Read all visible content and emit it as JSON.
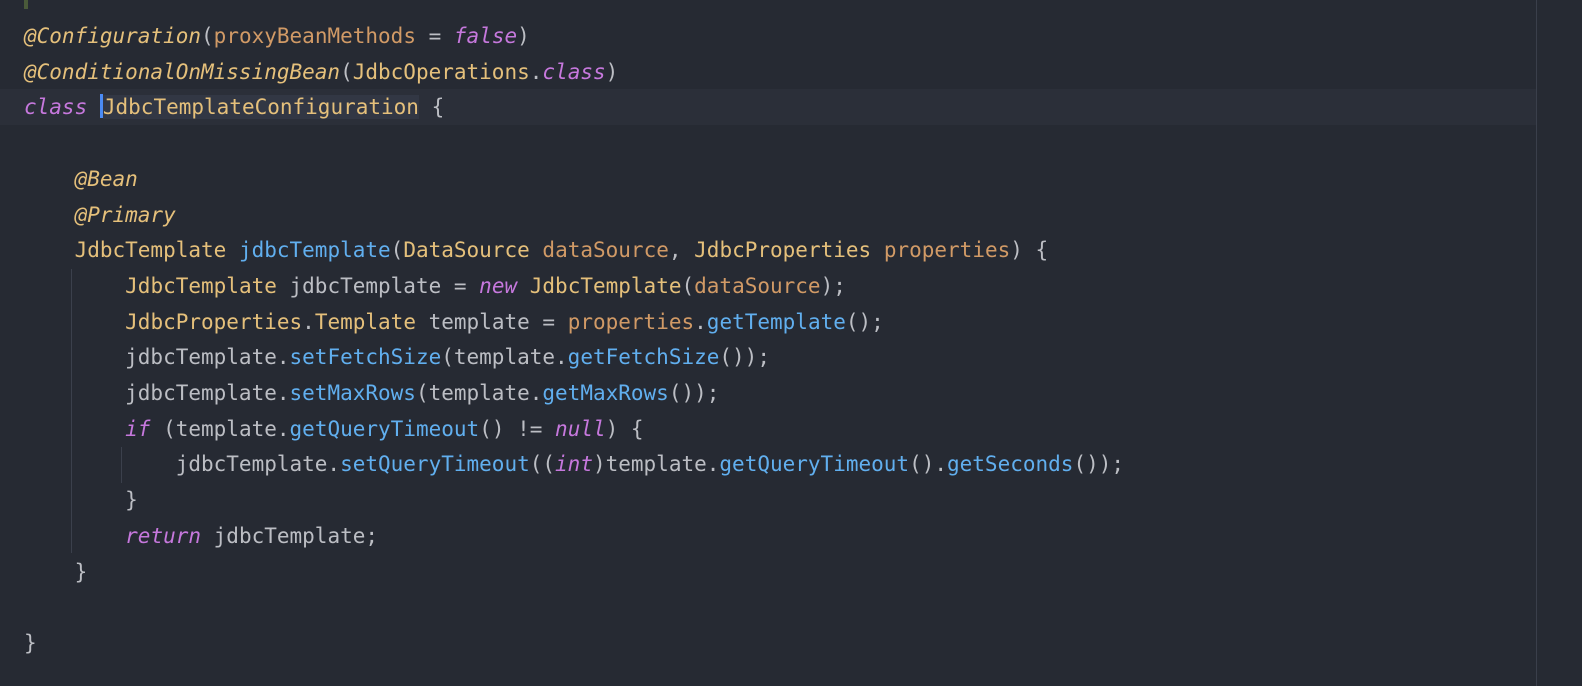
{
  "editor": {
    "lines": [
      {
        "tokens": [
          {
            "t": "@Configuration",
            "c": "ann"
          },
          {
            "t": "(",
            "c": "punct"
          },
          {
            "t": "proxyBeanMethods",
            "c": "param"
          },
          {
            "t": " = ",
            "c": "plain"
          },
          {
            "t": "false",
            "c": "kw"
          },
          {
            "t": ")",
            "c": "punct"
          }
        ]
      },
      {
        "tokens": [
          {
            "t": "@ConditionalOnMissingBean",
            "c": "ann"
          },
          {
            "t": "(",
            "c": "punct"
          },
          {
            "t": "JdbcOperations",
            "c": "type"
          },
          {
            "t": ".",
            "c": "punct"
          },
          {
            "t": "class",
            "c": "kw"
          },
          {
            "t": ")",
            "c": "punct"
          }
        ]
      },
      {
        "current": true,
        "tokens": [
          {
            "t": "class",
            "c": "kw"
          },
          {
            "t": " ",
            "c": "plain"
          },
          {
            "t": "JdbcTemplateConfiguration",
            "c": "type",
            "caret": true,
            "hl": true
          },
          {
            "t": " {",
            "c": "punct"
          }
        ]
      },
      {
        "tokens": []
      },
      {
        "tokens": [
          {
            "t": "    ",
            "c": "plain"
          },
          {
            "t": "@Bean",
            "c": "ann"
          }
        ]
      },
      {
        "tokens": [
          {
            "t": "    ",
            "c": "plain"
          },
          {
            "t": "@Primary",
            "c": "ann"
          }
        ]
      },
      {
        "tokens": [
          {
            "t": "    ",
            "c": "plain"
          },
          {
            "t": "JdbcTemplate",
            "c": "type"
          },
          {
            "t": " ",
            "c": "plain"
          },
          {
            "t": "jdbcTemplate",
            "c": "fn"
          },
          {
            "t": "(",
            "c": "punct"
          },
          {
            "t": "DataSource",
            "c": "type"
          },
          {
            "t": " ",
            "c": "plain"
          },
          {
            "t": "dataSource",
            "c": "param"
          },
          {
            "t": ", ",
            "c": "punct"
          },
          {
            "t": "JdbcProperties",
            "c": "type"
          },
          {
            "t": " ",
            "c": "plain"
          },
          {
            "t": "properties",
            "c": "param"
          },
          {
            "t": ") {",
            "c": "punct"
          }
        ]
      },
      {
        "tokens": [
          {
            "t": "        ",
            "c": "plain"
          },
          {
            "t": "JdbcTemplate",
            "c": "type"
          },
          {
            "t": " jdbcTemplate = ",
            "c": "plain"
          },
          {
            "t": "new",
            "c": "kw"
          },
          {
            "t": " ",
            "c": "plain"
          },
          {
            "t": "JdbcTemplate",
            "c": "type"
          },
          {
            "t": "(",
            "c": "punct"
          },
          {
            "t": "dataSource",
            "c": "param"
          },
          {
            "t": ");",
            "c": "punct"
          }
        ]
      },
      {
        "tokens": [
          {
            "t": "        ",
            "c": "plain"
          },
          {
            "t": "JdbcProperties",
            "c": "type"
          },
          {
            "t": ".",
            "c": "punct"
          },
          {
            "t": "Template",
            "c": "type"
          },
          {
            "t": " template = ",
            "c": "plain"
          },
          {
            "t": "properties",
            "c": "param"
          },
          {
            "t": ".",
            "c": "punct"
          },
          {
            "t": "getTemplate",
            "c": "fn"
          },
          {
            "t": "();",
            "c": "punct"
          }
        ]
      },
      {
        "tokens": [
          {
            "t": "        jdbcTemplate.",
            "c": "plain"
          },
          {
            "t": "setFetchSize",
            "c": "fn"
          },
          {
            "t": "(template.",
            "c": "plain"
          },
          {
            "t": "getFetchSize",
            "c": "fn"
          },
          {
            "t": "());",
            "c": "punct"
          }
        ]
      },
      {
        "tokens": [
          {
            "t": "        jdbcTemplate.",
            "c": "plain"
          },
          {
            "t": "setMaxRows",
            "c": "fn"
          },
          {
            "t": "(template.",
            "c": "plain"
          },
          {
            "t": "getMaxRows",
            "c": "fn"
          },
          {
            "t": "());",
            "c": "punct"
          }
        ]
      },
      {
        "tokens": [
          {
            "t": "        ",
            "c": "plain"
          },
          {
            "t": "if",
            "c": "kw"
          },
          {
            "t": " (template.",
            "c": "plain"
          },
          {
            "t": "getQueryTimeout",
            "c": "fn"
          },
          {
            "t": "() != ",
            "c": "plain"
          },
          {
            "t": "null",
            "c": "kw"
          },
          {
            "t": ") {",
            "c": "punct"
          }
        ]
      },
      {
        "tokens": [
          {
            "t": "            jdbcTemplate.",
            "c": "plain"
          },
          {
            "t": "setQueryTimeout",
            "c": "fn"
          },
          {
            "t": "((",
            "c": "punct"
          },
          {
            "t": "int",
            "c": "kw"
          },
          {
            "t": ")template.",
            "c": "plain"
          },
          {
            "t": "getQueryTimeout",
            "c": "fn"
          },
          {
            "t": "().",
            "c": "punct"
          },
          {
            "t": "getSeconds",
            "c": "fn"
          },
          {
            "t": "());",
            "c": "punct"
          }
        ]
      },
      {
        "tokens": [
          {
            "t": "        }",
            "c": "punct"
          }
        ]
      },
      {
        "tokens": [
          {
            "t": "        ",
            "c": "plain"
          },
          {
            "t": "return",
            "c": "kw"
          },
          {
            "t": " jdbcTemplate;",
            "c": "plain"
          }
        ]
      },
      {
        "tokens": [
          {
            "t": "    }",
            "c": "punct"
          }
        ]
      },
      {
        "tokens": []
      },
      {
        "tokens": [
          {
            "t": "}",
            "c": "punct"
          }
        ]
      }
    ]
  }
}
